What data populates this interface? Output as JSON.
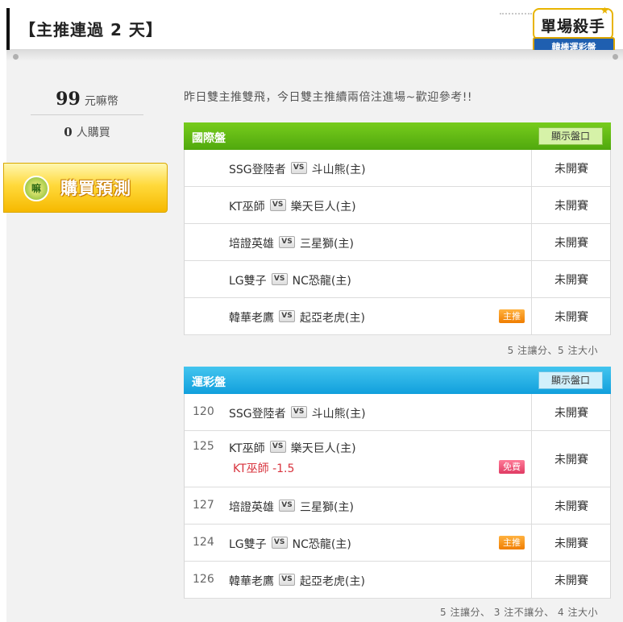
{
  "header": {
    "title": "【主推連過 2 天】"
  },
  "badge": {
    "title": "單場殺手",
    "subtitle": "韓棒運彩盤"
  },
  "sidebar": {
    "price_value": "99",
    "price_unit": "元嘛幣",
    "buyers_value": "0",
    "buyers_unit": "人購買",
    "buy_button_label": "購買預測",
    "coin_glyph": "嘛"
  },
  "intro_text": "昨日雙主推雙飛，今日雙主推續兩倍注進場~歡迎參考!!",
  "international": {
    "title": "國際盤",
    "show_odds_label": "顯示盤口",
    "rows": [
      {
        "away": "SSG登陸者",
        "home": "斗山熊(主)",
        "status": "未開賽"
      },
      {
        "away": "KT巫師",
        "home": "樂天巨人(主)",
        "status": "未開賽"
      },
      {
        "away": "培證英雄",
        "home": "三星獅(主)",
        "status": "未開賽"
      },
      {
        "away": "LG雙子",
        "home": "NC恐龍(主)",
        "status": "未開賽"
      },
      {
        "away": "韓華老鷹",
        "home": "起亞老虎(主)",
        "status": "未開賽",
        "tag": "主推"
      }
    ],
    "summary": "5 注讓分、5 注大小"
  },
  "lottery": {
    "title": "運彩盤",
    "show_odds_label": "顯示盤口",
    "rows": [
      {
        "code": "120",
        "away": "SSG登陸者",
        "home": "斗山熊(主)",
        "status": "未開賽"
      },
      {
        "code": "125",
        "away": "KT巫師",
        "home": "樂天巨人(主)",
        "status": "未開賽",
        "pick": "KT巫師 -1.5",
        "tag": "免費"
      },
      {
        "code": "127",
        "away": "培證英雄",
        "home": "三星獅(主)",
        "status": "未開賽"
      },
      {
        "code": "124",
        "away": "LG雙子",
        "home": "NC恐龍(主)",
        "status": "未開賽",
        "tag": "主推"
      },
      {
        "code": "126",
        "away": "韓華老鷹",
        "home": "起亞老虎(主)",
        "status": "未開賽"
      }
    ],
    "summary": "5 注讓分、 3 注不讓分、 4 注大小"
  },
  "vs_label": "VS",
  "colors": {
    "green_header": "#5cb711",
    "blue_header": "#1aa8e2",
    "tag_orange": "#f28a0a",
    "tag_pink": "#e8476d",
    "pick_red": "#d8343e",
    "buy_button_gold": "#ffd12e"
  }
}
